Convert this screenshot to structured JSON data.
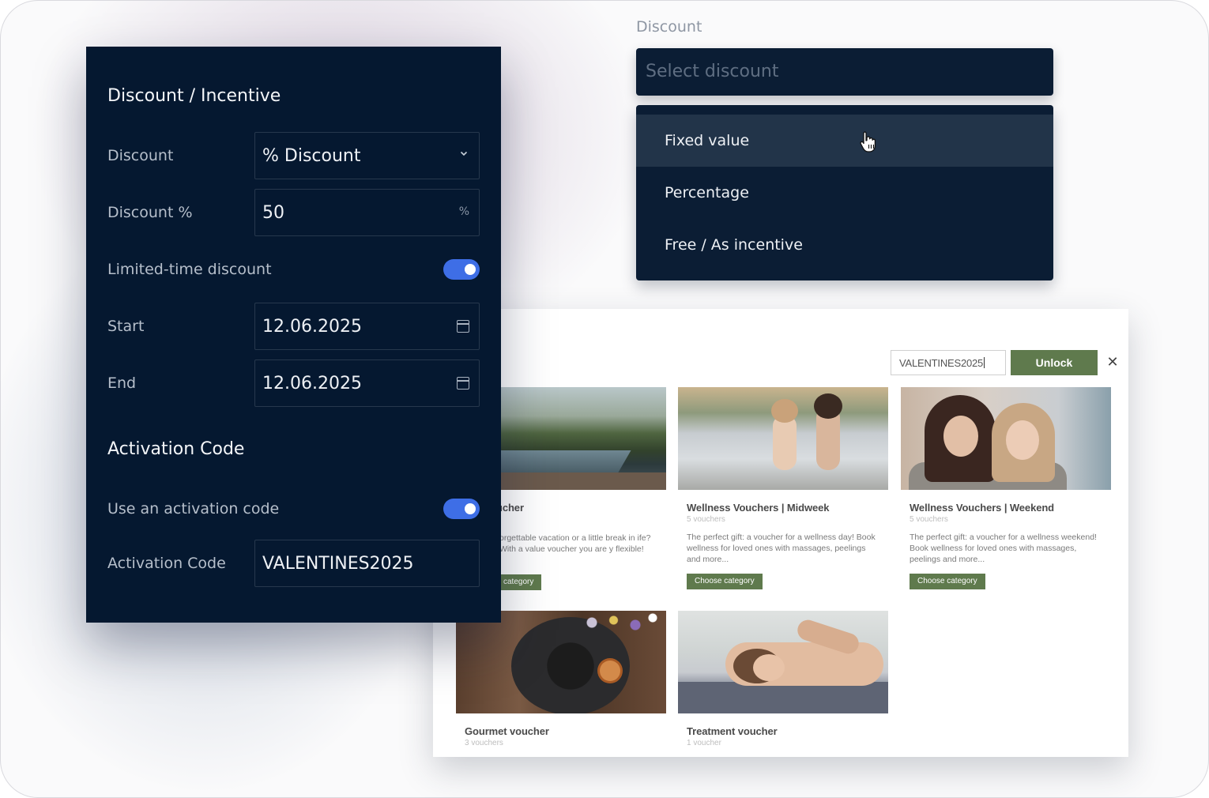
{
  "colors": {
    "panel_bg": "#051830",
    "accent_toggle": "#3e6ee6",
    "shop_green": "#5f7a4d",
    "dropdown_hover": "#223449"
  },
  "discount_dropdown": {
    "label": "Discount",
    "placeholder": "Select discount",
    "options": [
      {
        "label": "Fixed value",
        "hovered": true
      },
      {
        "label": "Percentage",
        "hovered": false
      },
      {
        "label": "Free / As incentive",
        "hovered": false
      }
    ]
  },
  "settings_panel": {
    "section1_title": "Discount / Incentive",
    "discount_label": "Discount",
    "discount_value": "% Discount",
    "discount_pct_label": "Discount %",
    "discount_pct_value": "50",
    "discount_pct_suffix": "%",
    "limited_label": "Limited-time discount",
    "limited_enabled": true,
    "start_label": "Start",
    "start_value": "12.06.2025",
    "end_label": "End",
    "end_value": "12.06.2025",
    "section2_title": "Activation Code",
    "use_code_label": "Use an activation code",
    "use_code_enabled": true,
    "code_label": "Activation Code",
    "code_value": "VALENTINES2025"
  },
  "voucher_shop": {
    "code_input_value": "VALENTINES2025",
    "unlock_label": "Unlock",
    "close_icon": "close-icon",
    "cards": [
      {
        "title": "ucher",
        "count": "",
        "description": "orgettable vacation or a little break in ife? With a value voucher you are y flexible!",
        "button": "category"
      },
      {
        "title": "Wellness Vouchers | Midweek",
        "count": "5 vouchers",
        "description": "The perfect gift: a voucher for a wellness day! Book wellness for loved ones with massages, peelings and more...",
        "button": "Choose category"
      },
      {
        "title": "Wellness Vouchers | Weekend",
        "count": "5 vouchers",
        "description": "The perfect gift: a voucher for a wellness weekend! Book wellness for loved ones with massages, peelings and more...",
        "button": "Choose category"
      },
      {
        "title": "Gourmet voucher",
        "count": "3 vouchers"
      },
      {
        "title": "Treatment voucher",
        "count": "1 voucher"
      }
    ]
  }
}
